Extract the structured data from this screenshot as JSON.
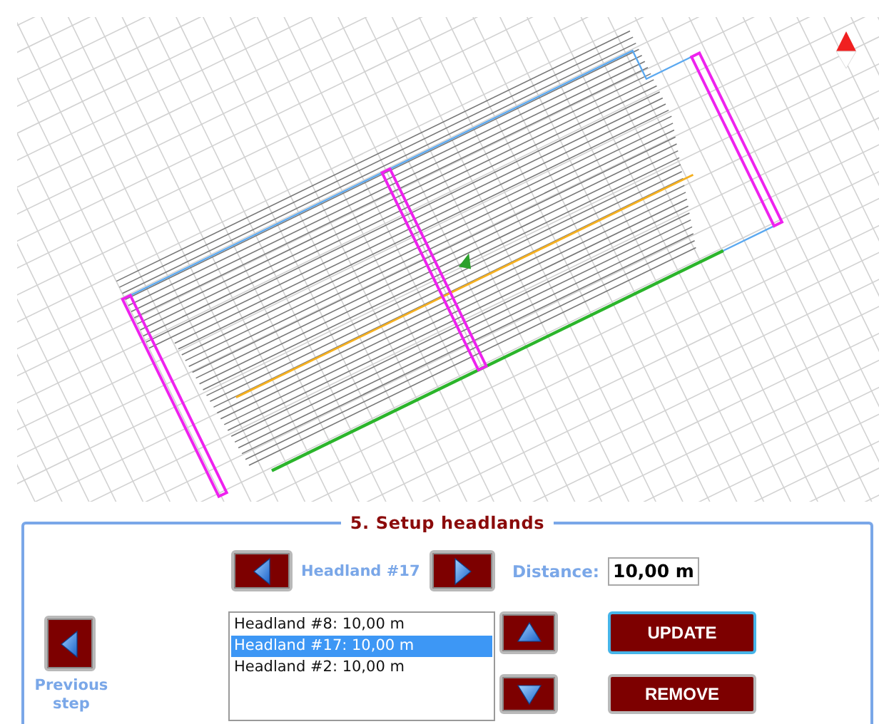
{
  "panel": {
    "title": "5. Setup headlands"
  },
  "navigator": {
    "label": "Headland #17"
  },
  "distance": {
    "label": "Distance:",
    "value": "10,00 m"
  },
  "headlands": [
    {
      "label": "Headland #8: 10,00 m",
      "selected": false
    },
    {
      "label": "Headland #17: 10,00 m",
      "selected": true
    },
    {
      "label": "Headland #2: 10,00 m",
      "selected": false
    }
  ],
  "actions": [
    {
      "label": "UPDATE",
      "focused": true
    },
    {
      "label": "REMOVE",
      "focused": false
    }
  ],
  "previous_step": {
    "label": "Previous\nstep"
  }
}
